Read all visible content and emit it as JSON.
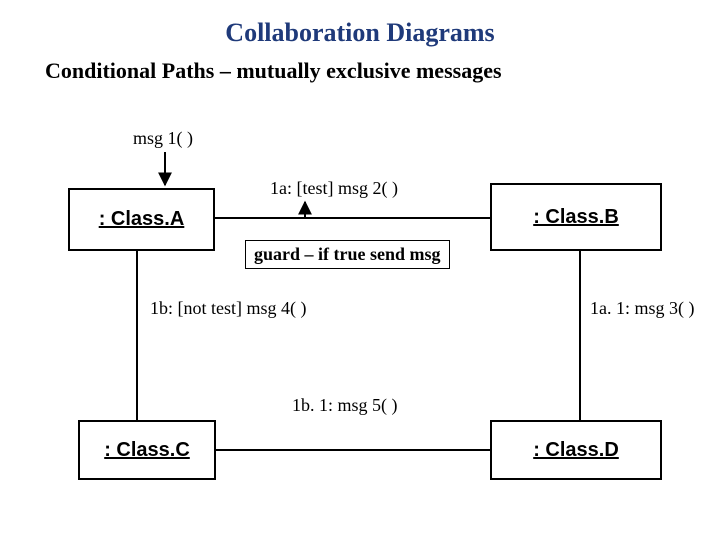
{
  "title": "Collaboration Diagrams",
  "subtitle": "Conditional Paths – mutually exclusive messages",
  "objects": {
    "classA": ": Class.A",
    "classB": ": Class.B",
    "classC": ": Class.C",
    "classD": ": Class.D"
  },
  "labels": {
    "msg1": "msg 1( )",
    "msg2": "1a:  [test] msg 2( )",
    "msg3": "1a. 1: msg 3( )",
    "msg4": "1b: [not test] msg 4( )",
    "msg5": "1b. 1: msg 5( )"
  },
  "note": "guard – if true send msg"
}
